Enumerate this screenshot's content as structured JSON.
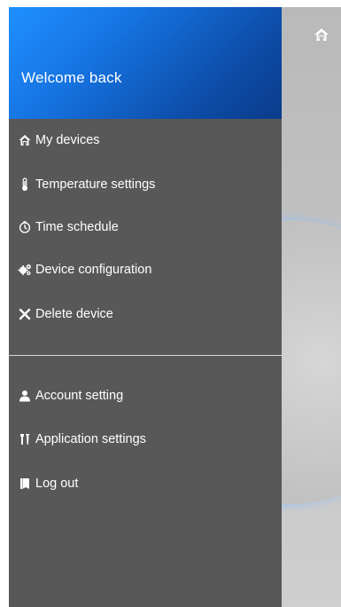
{
  "header": {
    "welcome": "Welcome back"
  },
  "menu": {
    "primary": [
      {
        "label": "My devices",
        "icon": "home-icon"
      },
      {
        "label": "Temperature settings",
        "icon": "thermometer-icon"
      },
      {
        "label": "Time schedule",
        "icon": "timer-icon"
      },
      {
        "label": "Device configuration",
        "icon": "gears-icon"
      },
      {
        "label": "Delete device",
        "icon": "close-icon"
      }
    ],
    "secondary": [
      {
        "label": "Account setting",
        "icon": "user-icon"
      },
      {
        "label": "Application settings",
        "icon": "tools-icon"
      },
      {
        "label": "Log out",
        "icon": "logout-icon"
      }
    ]
  },
  "colors": {
    "drawer_bg": "#585858",
    "header_gradient_start": "#1f90ff",
    "header_gradient_end": "#0a3b8a",
    "backdrop": "#c9c9c9",
    "divider": "#d8d8d8"
  }
}
